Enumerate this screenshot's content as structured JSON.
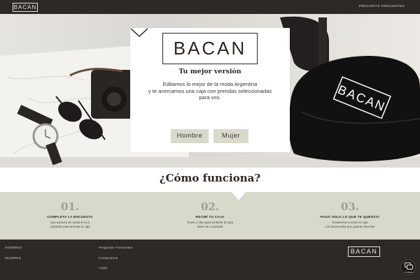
{
  "header": {
    "logo": "BACAN",
    "faq_link": "PREGUNTAS FRECUENTES"
  },
  "hero": {
    "logo": "BACAN",
    "tagline": "Tu mejor versión",
    "text_line1": "Editamos lo mejor de la moda Argentina",
    "text_line2": "y te acercamos una caja con prendas seleccionadas",
    "text_line3": "para vos.",
    "button_hombre": "Hombre",
    "button_mujer": "Mujer",
    "cap_text": "BACAN",
    "icons": [
      "chevron-down-icon"
    ]
  },
  "how": {
    "title": "¿Cómo funciona?",
    "steps": [
      {
        "num": "01.",
        "title": "COMPLETA LA ENCUESTA",
        "desc1": "Una asesora de moda te va a",
        "desc2": "contactar para armarte tu caja"
      },
      {
        "num": "02.",
        "title": "RECIBÍ TU CAJA",
        "desc1": "Tenés 4 días para probarte la ropa",
        "desc2": "antes de comprarla"
      },
      {
        "num": "03.",
        "title": "PAGÁ SOLO LO QUE TE QUEDÁS!",
        "desc1": "Pasaremos a retirar la caja",
        "desc2": "con las prendas que quieras devolver"
      }
    ]
  },
  "footer": {
    "hombres": "HOMBRES",
    "mujeres": "MUJERES",
    "faq": "Preguntas Frecuentes",
    "contact": "Contactanos",
    "legal": "Legal",
    "logo": "BACAN",
    "chat_label": "Contacto"
  },
  "colors": {
    "dark": "#2e2826",
    "band": "#d9d9cb",
    "button": "#d9d9cc",
    "step_number": "#9e9e93"
  }
}
